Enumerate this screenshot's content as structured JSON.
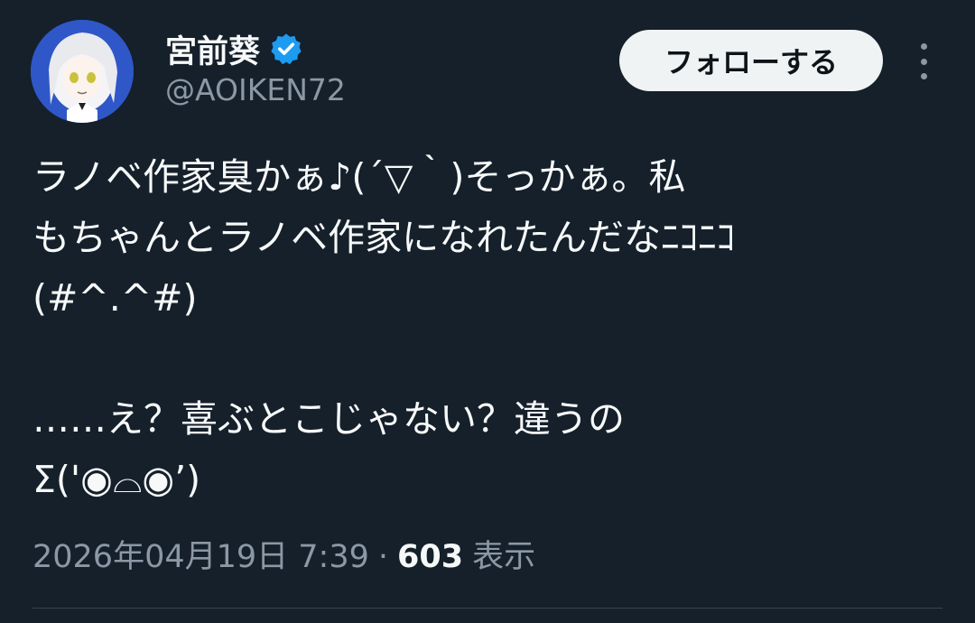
{
  "author": {
    "display_name": "宮前葵",
    "handle": "@AOIKEN72",
    "verified_icon": "verified-badge-icon",
    "avatar_icon": "avatar"
  },
  "actions": {
    "follow_label": "フォローする",
    "more_icon": "more-vertical-icon"
  },
  "tweet": {
    "lines": [
      "ラノベ作家臭かぁ♪(´▽｀)そっかぁ。私",
      "もちゃんとラノベ作家になれたんだなﾆｺﾆｺ",
      "(#^.^#)",
      "",
      "……え？喜ぶとこじゃない？違うの",
      "Σ('◉⌓◉’)"
    ]
  },
  "meta": {
    "timestamp": "2026年04月19日 7:39",
    "separator": "·",
    "views_count": "603",
    "views_label": "表示"
  },
  "colors": {
    "background": "#15202b",
    "primary_text": "#f7f9f9",
    "secondary_text": "#8b98a5",
    "verified_blue": "#1d9bf0",
    "follow_button_bg": "#eff3f4"
  }
}
